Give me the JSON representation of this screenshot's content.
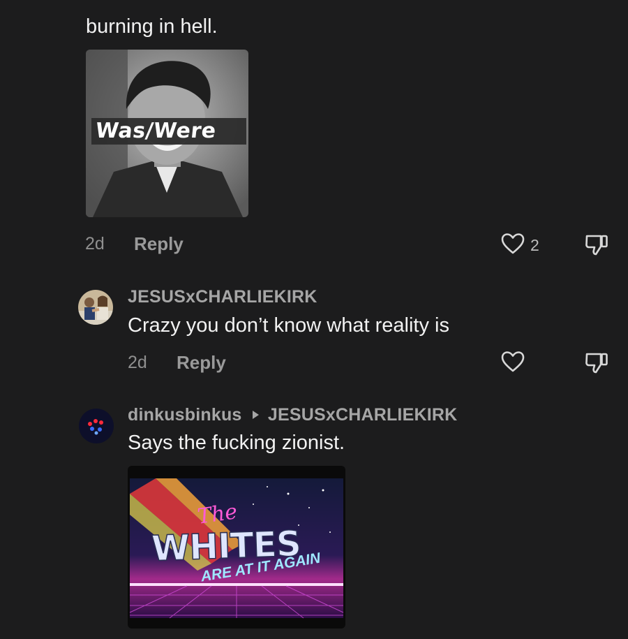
{
  "comments": [
    {
      "text_tail": "burning in hell.",
      "image": {
        "caption": "Was/Were"
      },
      "time": "2d",
      "reply_label": "Reply",
      "like_count": "2"
    },
    {
      "username": "JESUSxCHARLIEKIRK",
      "text": "Crazy you don’t know what reality is",
      "time": "2d",
      "reply_label": "Reply"
    },
    {
      "username": "dinkusbinkus",
      "reply_to": "JESUSxCHARLIEKIRK",
      "text": "Says the fucking zionist.",
      "image": {
        "line1": "The",
        "line2": "WHITES",
        "line3": "ARE AT IT AGAIN"
      }
    }
  ],
  "icons": {
    "like": "heart-outline-icon",
    "dislike": "thumbs-down-icon",
    "reply_arrow": "play-triangle-icon"
  },
  "colors": {
    "background": "#1c1c1d",
    "primary_text": "#f2f2f2",
    "secondary_text": "#8f8f8f"
  }
}
